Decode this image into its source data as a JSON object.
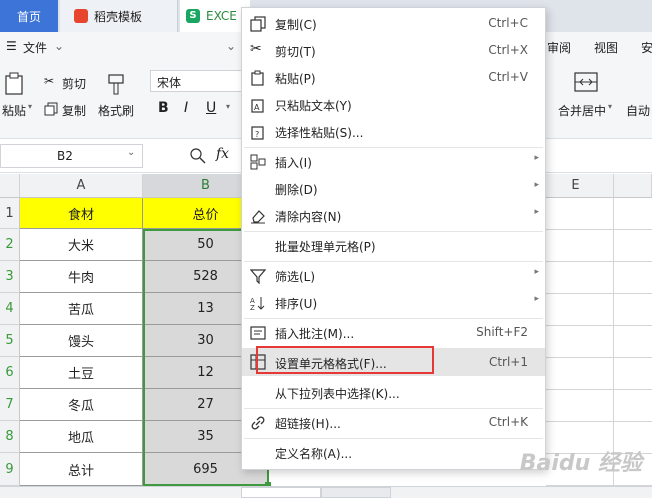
{
  "tabs": {
    "home": "首页",
    "doc": "稻壳模板",
    "excel": "EXCE"
  },
  "menu": {
    "file": "文件",
    "review": "审阅",
    "view": "视图",
    "security": "安"
  },
  "ribbon": {
    "paste": "粘贴",
    "cut": "剪切",
    "copy": "复制",
    "format_painter": "格式刷",
    "font_name": "宋体",
    "bold": "B",
    "italic": "I",
    "underline": "U",
    "merge": "合并居中",
    "auto": "自动"
  },
  "formula_bar": {
    "name_box": "B2",
    "fx": "fx"
  },
  "sheet": {
    "columns": [
      "A",
      "B",
      "E"
    ],
    "rows": [
      "1",
      "2",
      "3",
      "4",
      "5",
      "6",
      "7",
      "8",
      "9"
    ],
    "header": {
      "a": "食材",
      "b": "总价"
    },
    "data": [
      {
        "a": "大米",
        "b": "50"
      },
      {
        "a": "牛肉",
        "b": "528"
      },
      {
        "a": "苦瓜",
        "b": "13"
      },
      {
        "a": "馒头",
        "b": "30"
      },
      {
        "a": "土豆",
        "b": "12"
      },
      {
        "a": "冬瓜",
        "b": "27"
      },
      {
        "a": "地瓜",
        "b": "35"
      },
      {
        "a": "总计",
        "b": "695"
      }
    ]
  },
  "context_menu": {
    "items": [
      {
        "label": "复制(C)",
        "shortcut": "Ctrl+C",
        "icon": "copy-icon"
      },
      {
        "label": "剪切(T)",
        "shortcut": "Ctrl+X",
        "icon": "scissors-icon"
      },
      {
        "label": "粘贴(P)",
        "shortcut": "Ctrl+V",
        "icon": "paste-icon"
      },
      {
        "label": "只粘贴文本(Y)",
        "shortcut": "",
        "icon": "paste-text-icon"
      },
      {
        "label": "选择性粘贴(S)...",
        "shortcut": "",
        "icon": "paste-special-icon"
      },
      {
        "label": "插入(I)",
        "shortcut": "",
        "icon": "insert-icon"
      },
      {
        "label": "删除(D)",
        "shortcut": "",
        "icon": ""
      },
      {
        "label": "清除内容(N)",
        "shortcut": "",
        "icon": "eraser-icon"
      },
      {
        "label": "批量处理单元格(P)",
        "shortcut": "",
        "icon": ""
      },
      {
        "label": "筛选(L)",
        "shortcut": "",
        "icon": "filter-icon"
      },
      {
        "label": "排序(U)",
        "shortcut": "",
        "icon": "sort-icon"
      },
      {
        "label": "插入批注(M)...",
        "shortcut": "Shift+F2",
        "icon": "comment-icon"
      },
      {
        "label": "设置单元格格式(F)...",
        "shortcut": "Ctrl+1",
        "icon": "format-cells-icon"
      },
      {
        "label": "从下拉列表中选择(K)...",
        "shortcut": "",
        "icon": ""
      },
      {
        "label": "超链接(H)...",
        "shortcut": "Ctrl+K",
        "icon": "link-icon"
      },
      {
        "label": "定义名称(A)...",
        "shortcut": "",
        "icon": ""
      }
    ]
  },
  "colors": {
    "tab_active": "#3d74d8",
    "header_fill": "#ffff00",
    "selection_fill": "#d9d9d9",
    "selection_border": "#3f9a3f",
    "highlight_box": "#e53935"
  }
}
